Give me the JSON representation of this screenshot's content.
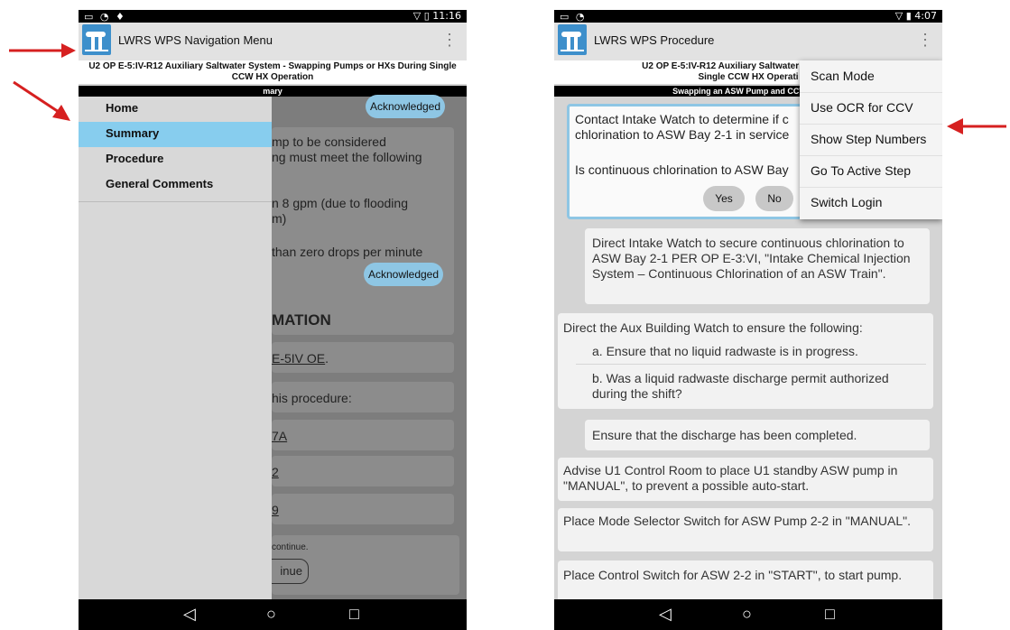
{
  "left": {
    "status_time": "11:16",
    "app_title": "LWRS WPS Navigation Menu",
    "doc_title": "U2 OP E-5:IV-R12 Auxiliary Saltwater System - Swapping Pumps or HXs During Single CCW HX Operation",
    "section_bar": "mary",
    "drawer_items": [
      "Home",
      "Summary",
      "Procedure",
      "General Comments"
    ],
    "content": {
      "card1_text": "mp to be considered\nng must meet the following",
      "card2_text": "n 8 gpm (due to flooding\nm)",
      "card3_text": "than zero drops per minute",
      "acknowledged": "Acknowledged",
      "heading": "MATION",
      "link1": "E-5IV OE",
      "link1_suffix": ".",
      "card_proc": "his procedure:",
      "link2": "7A",
      "link3": "2",
      "link4": "9",
      "continue_text": "continue.",
      "continue_btn": "inue"
    }
  },
  "right": {
    "status_time": "4:07",
    "app_title": "LWRS WPS Procedure",
    "doc_title": "U2 OP E-5:IV-R12 Auxiliary Saltwater System - Sw\nSingle CCW HX Operati",
    "section_bar": "Swapping an ASW Pump and CCW Hea",
    "step_active": {
      "text1": "Contact Intake Watch to determine if c\nchlorination to ASW Bay 2-1 in service",
      "question": "Is continuous chlorination to ASW Bay",
      "yes": "Yes",
      "no": "No"
    },
    "steps": [
      "Direct Intake Watch to secure continuous chlorination to ASW Bay 2-1 PER OP E-3:VI, \"Intake Chemical Injection System – Continuous Chlorination of an ASW Train\".",
      "Direct the Aux Building Watch to ensure the following:",
      "a. Ensure that no liquid radwaste is in progress.",
      "b. Was a liquid radwaste discharge permit authorized during the shift?",
      "Ensure that the discharge has been completed.",
      "Advise U1 Control Room to place U1 standby ASW pump in \"MANUAL\", to prevent a possible auto-start.",
      "Place Mode Selector Switch for ASW Pump 2-2 in \"MANUAL\".",
      "Place Control Switch for ASW 2-2 in \"START\", to start pump."
    ],
    "menu_items": [
      "Scan Mode",
      "Use OCR for CCV",
      "Show Step Numbers",
      "Go To Active Step",
      "Switch Login"
    ]
  },
  "icons": {
    "back": "◁",
    "home": "○",
    "recents": "□",
    "overflow": "⋮",
    "wifi": "wifi-icon",
    "battery": "battery-icon"
  },
  "colors": {
    "accent": "#8ec6e4",
    "selected_drawer": "#87cdee",
    "arrow": "#d62020",
    "logo": "#3d8fcb"
  }
}
